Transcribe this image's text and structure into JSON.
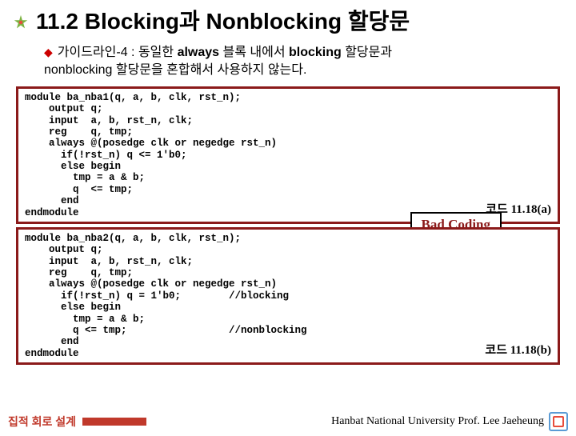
{
  "title": "11.2 Blocking과 Nonblocking 할당문",
  "guideline": {
    "bullet": "◆",
    "prefix": "가이드라인-4 : 동일한 ",
    "kw1": "always",
    "mid": " 블록 내에서 ",
    "kw2": "blocking",
    "suffix1": " 할당문과",
    "line2": "nonblocking 할당문을 혼합해서 사용하지 않는다."
  },
  "code1": "module ba_nba1(q, a, b, clk, rst_n);\n    output q;\n    input  a, b, rst_n, clk;\n    reg    q, tmp;\n    always @(posedge clk or negedge rst_n)\n      if(!rst_n) q <= 1'b0;\n      else begin\n        tmp = a & b;\n        q  <= tmp;\n      end\nendmodule",
  "code2": "module ba_nba2(q, a, b, clk, rst_n);\n    output q;\n    input  a, b, rst_n, clk;\n    reg    q, tmp;\n    always @(posedge clk or negedge rst_n)\n      if(!rst_n) q = 1'b0;        //blocking\n      else begin\n        tmp = a & b;\n        q <= tmp;                 //nonblocking\n      end\nendmodule",
  "badCoding": "Bad Coding",
  "label1": "코드 11.18(a)",
  "label2": "코드 11.18(b)",
  "footerLeft": "집적 회로 설계",
  "footerRight": "Hanbat National University Prof. Lee Jaeheung"
}
